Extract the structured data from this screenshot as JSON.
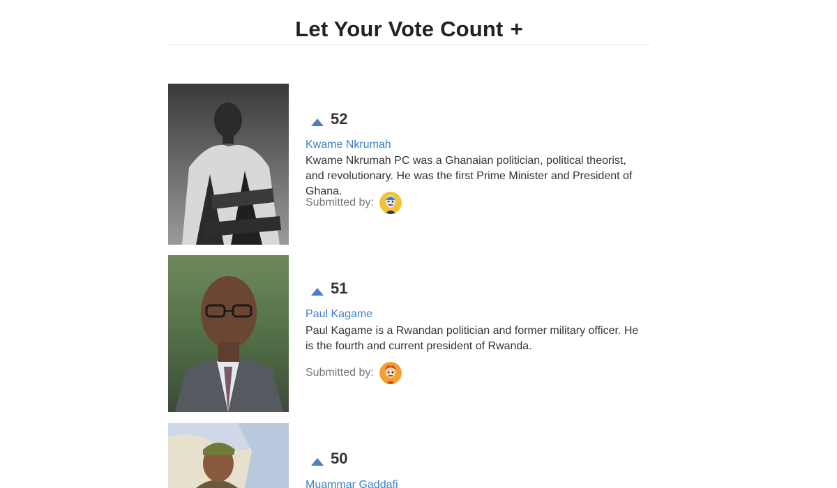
{
  "header": {
    "title": "Let Your Vote Count",
    "add_label": "+"
  },
  "submissions": [
    {
      "votes": "52",
      "name": "Kwame Nkrumah",
      "description": "Kwame Nkrumah PC was a Ghanaian politician, political theorist, and revolutionary. He was the first Prime Minister and President of Ghana.",
      "submitted_label": "Submitted by:",
      "avatar_icon": "avatar-blue-icon"
    },
    {
      "votes": "51",
      "name": "Paul Kagame",
      "description": "Paul Kagame is a Rwandan politician and former military officer. He is the fourth and current president of Rwanda.",
      "submitted_label": "Submitted by:",
      "avatar_icon": "avatar-orange-icon"
    },
    {
      "votes": "50",
      "name": "Muammar Gaddafi"
    }
  ],
  "colors": {
    "link": "#3b7fc6",
    "upvote": "#4a80bd",
    "avatar_1": "#f2c230",
    "avatar_2": "#f2a030"
  }
}
